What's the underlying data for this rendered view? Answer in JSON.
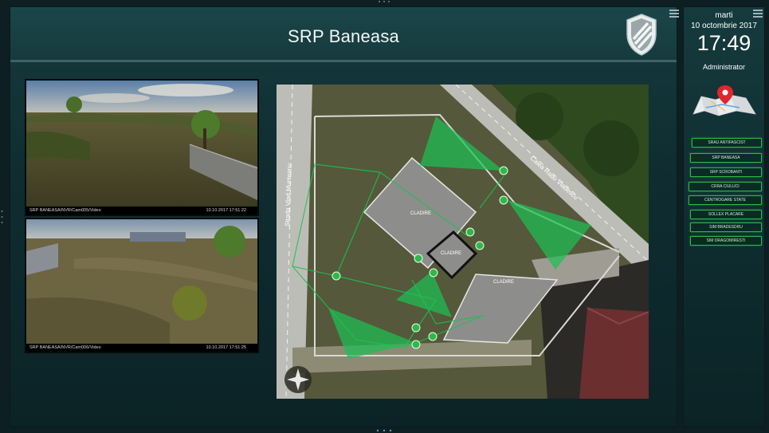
{
  "header": {
    "title": "SRP Baneasa"
  },
  "cameras": [
    {
      "path": "SRP BANEASA/NVR/Cam005/Video",
      "timestamp": "10.10.2017 17:51:22"
    },
    {
      "path": "SRP BANEASA/NVR/Cam006/Video",
      "timestamp": "10.10.2017 17:51:25"
    }
  ],
  "map": {
    "street_left": "Strada Vlad Munteanu",
    "street_right": "Calea Radu Vladescu",
    "buildings": [
      {
        "label": "CLADIRE"
      },
      {
        "label": "CLADIRE"
      },
      {
        "label": "CLADIRE"
      }
    ],
    "compass": "N"
  },
  "sidebar": {
    "day": "marti",
    "date": "10 octombrie 2017",
    "time": "17:49",
    "user": "Administrator",
    "sites": [
      "SRAU ANTIFASCIST",
      "SRP BANEASA",
      "SRP SCROBANTI",
      "CRRA CIULUCI",
      "CENTROGARE STATE",
      "SOLLEX PLACARE",
      "SIM BRADESDRU",
      "SIM DRAGOMIRESTI"
    ]
  },
  "colors": {
    "accent_green": "#2fb84a",
    "panel": "#163a3d",
    "zone_fill": "#1fbf55"
  }
}
